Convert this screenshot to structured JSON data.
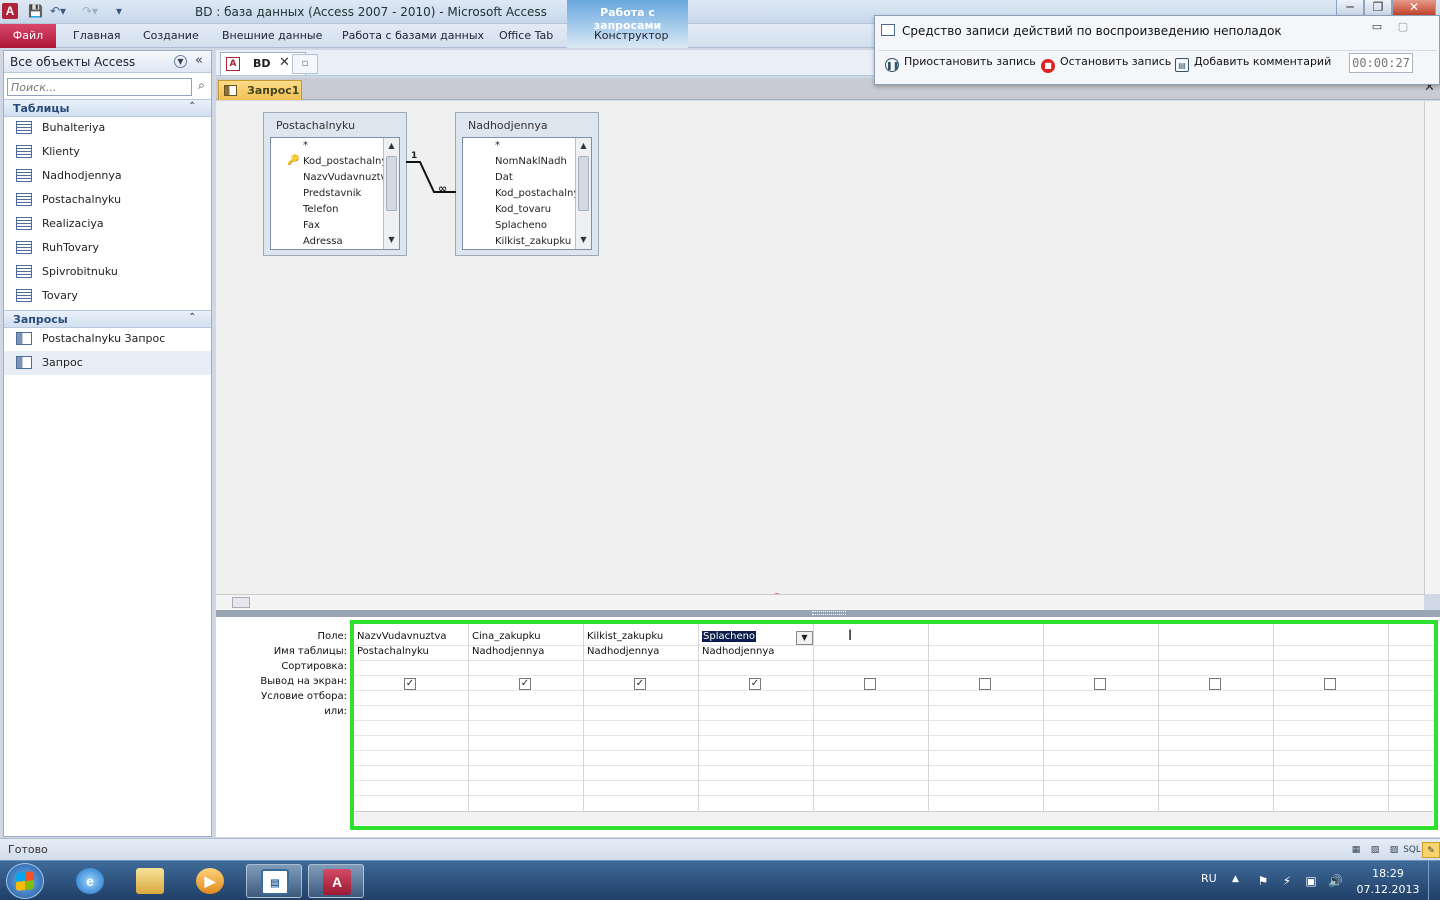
{
  "app": {
    "logo_letter": "A",
    "window_title": "BD : база данных (Access 2007 - 2010)  -  Microsoft Access",
    "context_tab_group": "Работа с запросами",
    "window_buttons": {
      "minimize": "─",
      "restore": "❐",
      "close": "✕"
    }
  },
  "ribbon": {
    "file_tab": "Файл",
    "tabs": [
      "Главная",
      "Создание",
      "Внешние данные",
      "Работа с базами данных",
      "Office Tab",
      "Конструктор"
    ]
  },
  "nav": {
    "title": "Все объекты Access",
    "search_placeholder": "Поиск...",
    "groups": [
      {
        "label": "Таблицы",
        "items": [
          "Buhalteriya",
          "Klienty",
          "Nadhodjennya",
          "Postachalnyku",
          "Realizaciya",
          "RuhTovary",
          "Spivrobitnuku",
          "Tovary"
        ]
      },
      {
        "label": "Запросы",
        "items": [
          "Postachalnyku Запрос",
          "Запрос"
        ]
      }
    ]
  },
  "doc_tabs": {
    "db_tab": "BD",
    "db_icon": "A",
    "close": "✕"
  },
  "object_tab": {
    "label": "Запрос1",
    "close": "✕"
  },
  "tables": [
    {
      "name": "Postachalnyku",
      "fields": [
        "*",
        "Kod_postachalnyku",
        "NazvVudavnuztva",
        "Predstavnik",
        "Telefon",
        "Fax",
        "Adressa"
      ],
      "key_field": "Kod_postachalnyku"
    },
    {
      "name": "Nadhodjennya",
      "fields": [
        "*",
        "NomNaklNadh",
        "Dat",
        "Kod_postachalnyku",
        "Kod_tovaru",
        "Splacheno",
        "Kilkist_zakupku"
      ]
    }
  ],
  "relationship": {
    "one_label": "1",
    "many_label": "∞"
  },
  "grid": {
    "row_labels": [
      "Поле:",
      "Имя таблицы:",
      "Сортировка:",
      "Вывод на экран:",
      "Условие отбора:",
      "или:"
    ],
    "columns": [
      {
        "field": "NazvVudavnuztva",
        "table": "Postachalnyku",
        "show": true
      },
      {
        "field": "Cina_zakupku",
        "table": "Nadhodjennya",
        "show": true
      },
      {
        "field": "Kilkist_zakupku",
        "table": "Nadhodjennya",
        "show": true
      },
      {
        "field": "Splacheno",
        "table": "Nadhodjennya",
        "show": true,
        "selected": true
      },
      {
        "field": "",
        "table": "",
        "show": false
      },
      {
        "field": "",
        "table": "",
        "show": false
      },
      {
        "field": "",
        "table": "",
        "show": false
      },
      {
        "field": "",
        "table": "",
        "show": false
      },
      {
        "field": "",
        "table": "",
        "show": false
      }
    ],
    "highlight_color": "#2ee12e"
  },
  "recorder": {
    "title": "Средство записи действий по воспроизведению неполадок",
    "pause_label": "Приостановить запись",
    "stop_label": "Остановить запись",
    "comment_label": "Добавить комментарий",
    "timer": "00:00:27"
  },
  "status": {
    "text": "Готово",
    "sql_label": "SQL"
  },
  "taskbar": {
    "lang": "RU",
    "time": "18:29",
    "date": "07.12.2013"
  }
}
